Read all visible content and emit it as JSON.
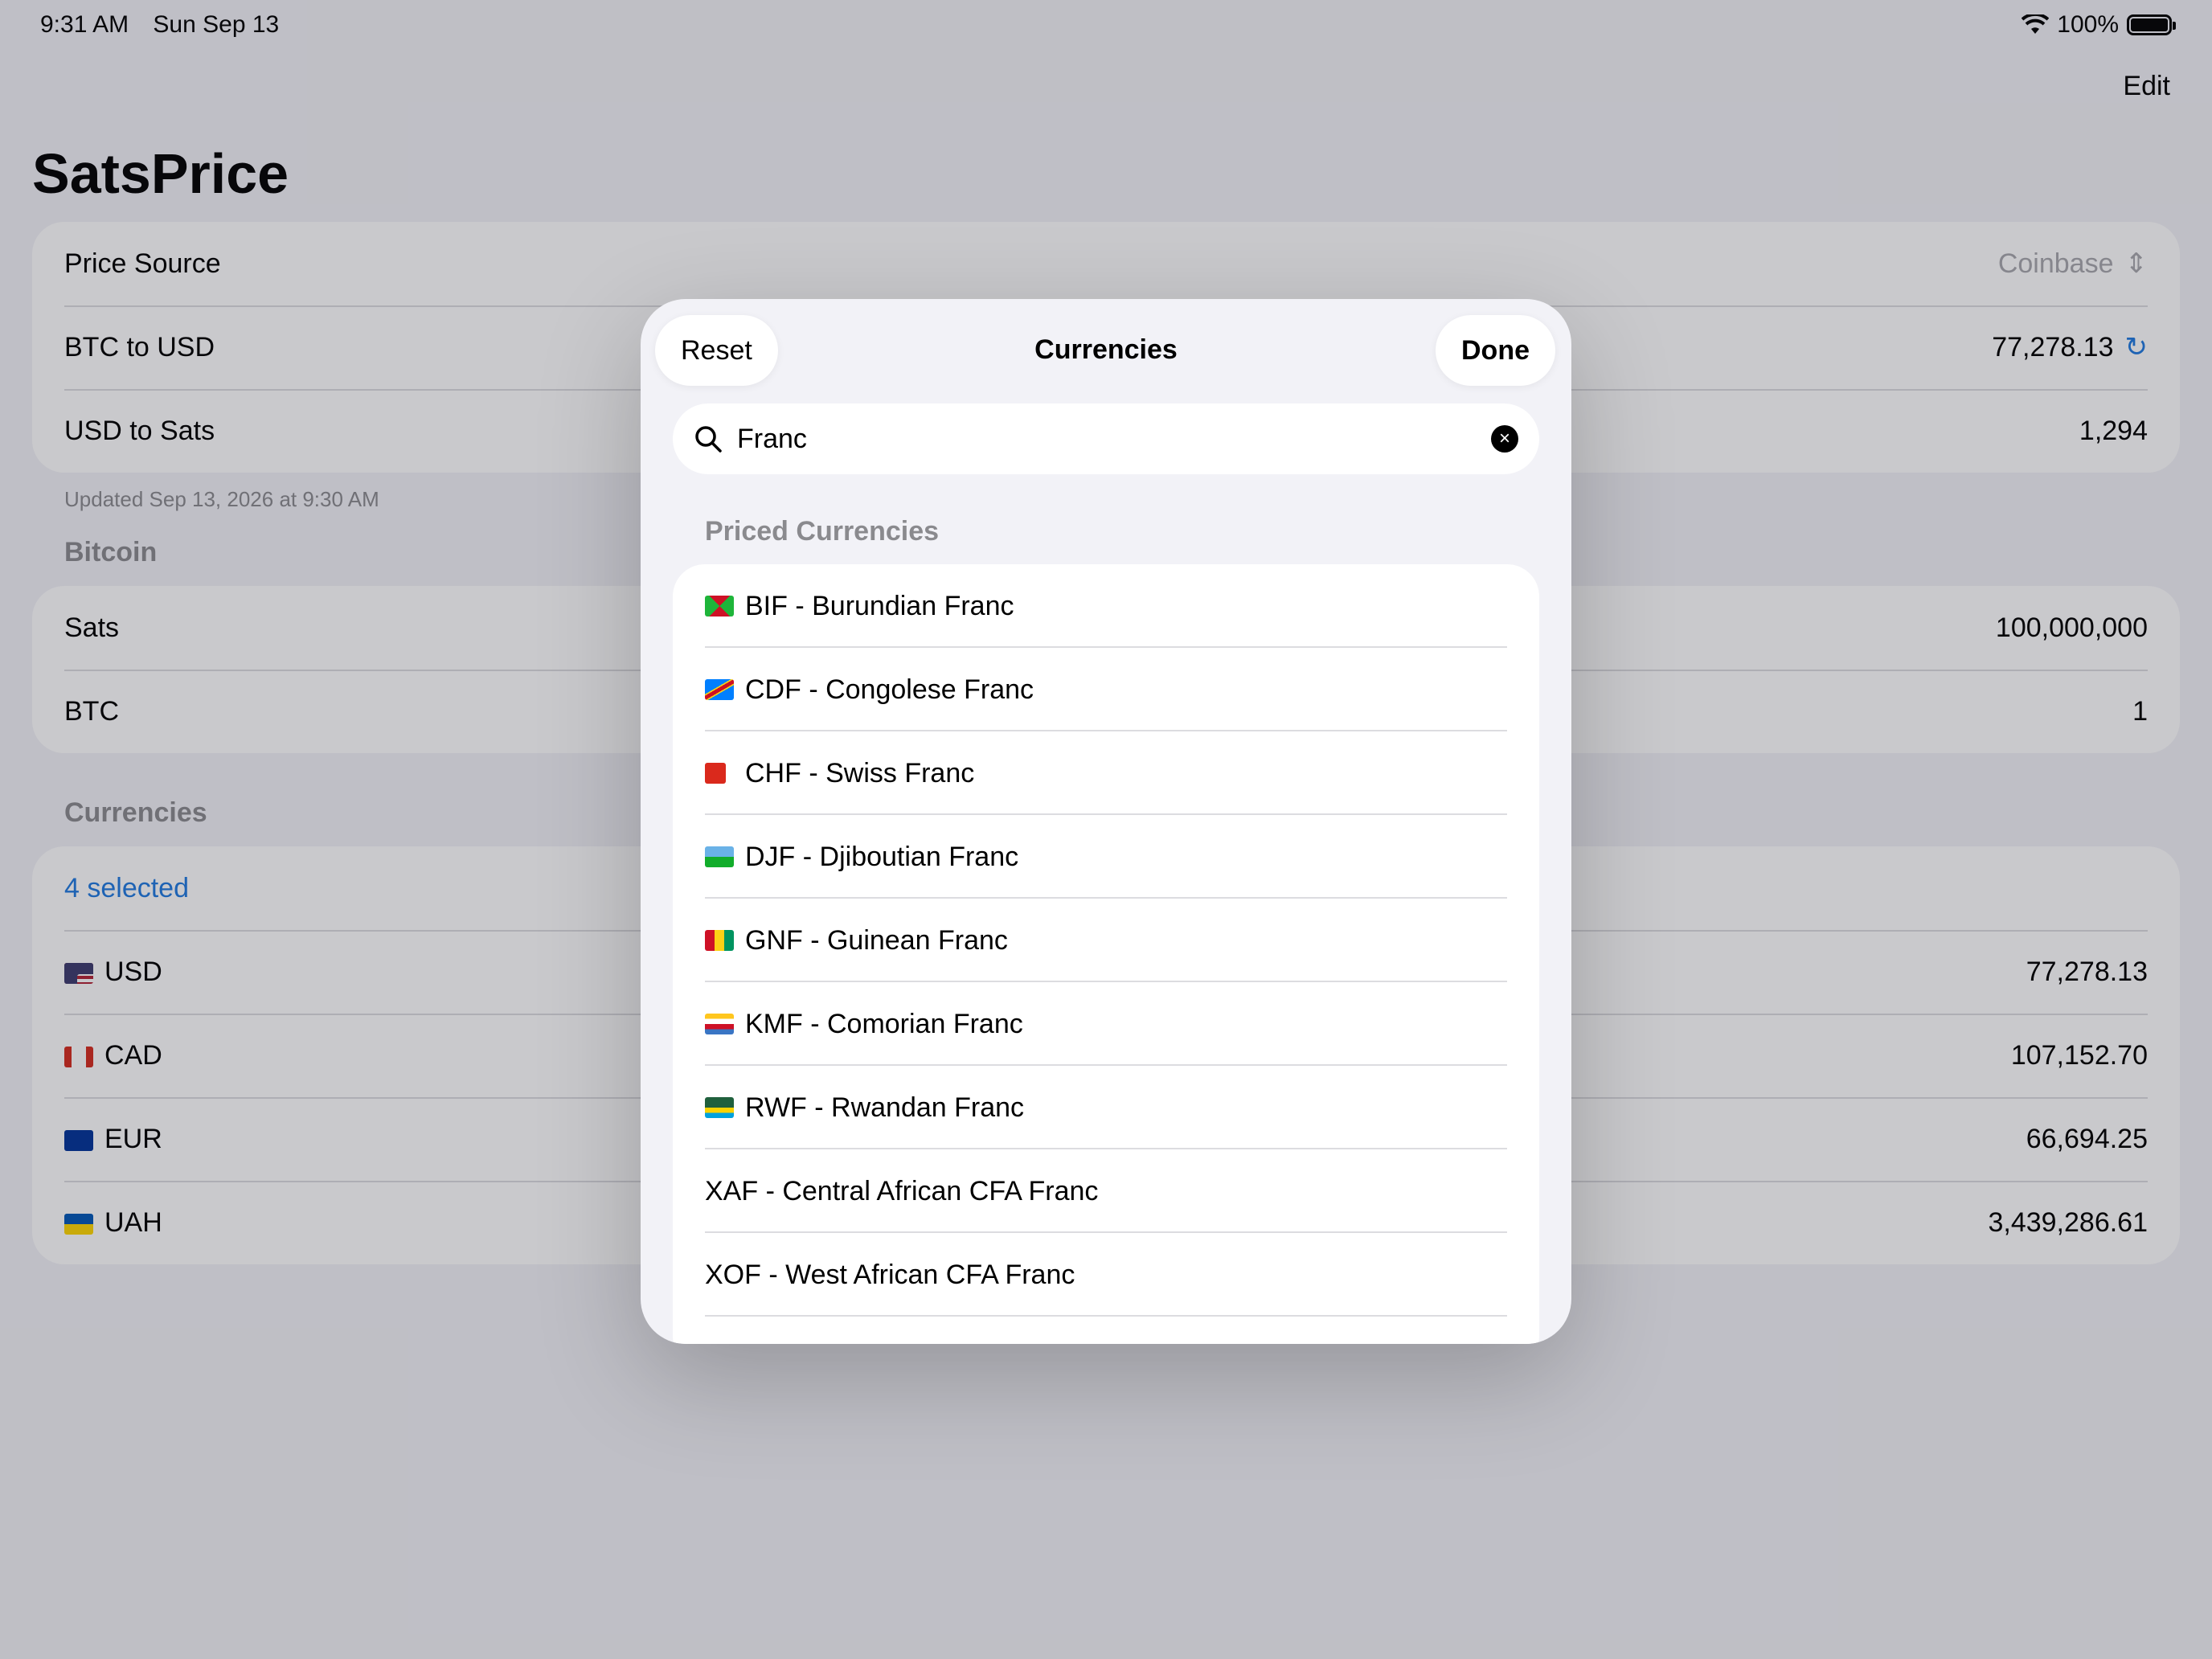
{
  "status_bar": {
    "time": "9:31 AM",
    "date": "Sun Sep 13",
    "battery": "100%"
  },
  "nav": {
    "edit_label": "Edit",
    "title": "SatsPrice"
  },
  "price": {
    "source_label": "Price Source",
    "source_value": "Coinbase",
    "btc_usd_label": "BTC to USD",
    "btc_usd_value": "77,278.13",
    "usd_sats_label": "USD to Sats",
    "usd_sats_value": "1,294",
    "updated": "Updated Sep 13, 2026 at 9:30 AM"
  },
  "bitcoin": {
    "header": "Bitcoin",
    "sats_label": "Sats",
    "sats_value": "100,000,000",
    "btc_label": "BTC",
    "btc_value": "1"
  },
  "currencies": {
    "header": "Currencies",
    "selected": "4 selected",
    "rows": [
      {
        "code": "USD",
        "value": "77,278.13"
      },
      {
        "code": "CAD",
        "value": "107,152.70"
      },
      {
        "code": "EUR",
        "value": "66,694.25"
      },
      {
        "code": "UAH",
        "value": "3,439,286.61"
      }
    ]
  },
  "modal": {
    "reset_label": "Reset",
    "title": "Currencies",
    "done_label": "Done",
    "search_value": "Franc",
    "section_header": "Priced Currencies",
    "items": [
      "BIF - Burundian Franc",
      "CDF - Congolese Franc",
      "CHF - Swiss Franc",
      "DJF - Djiboutian Franc",
      "GNF - Guinean Franc",
      "KMF - Comorian Franc",
      "RWF - Rwandan Franc",
      "XAF - Central African CFA Franc",
      "XOF - West African CFA Franc"
    ]
  },
  "colors": {
    "accent": "#1f7ae0",
    "background": "#f2f2f7",
    "separator": "#dcdce0"
  }
}
